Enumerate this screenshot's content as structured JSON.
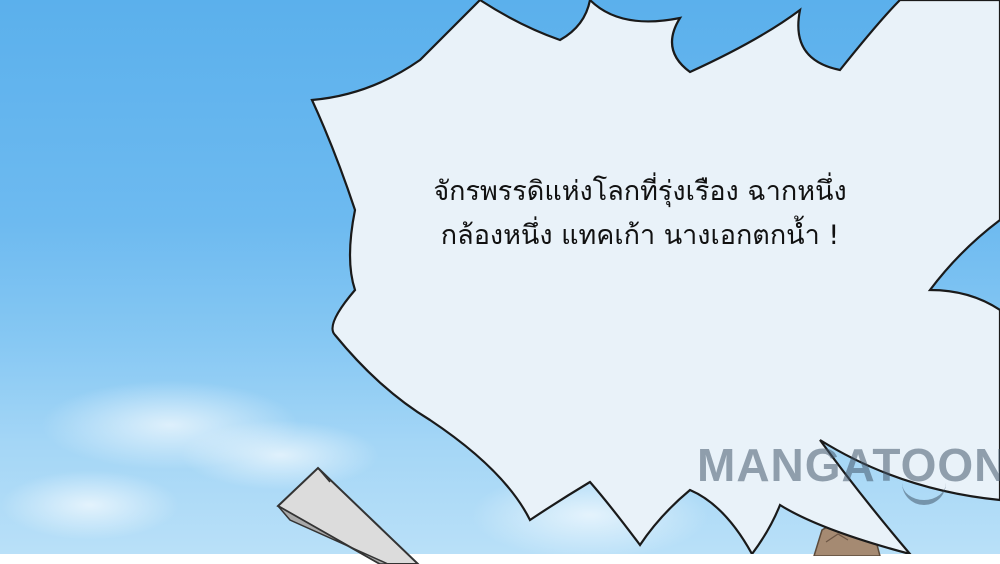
{
  "speech_bubble": {
    "lines": [
      "จักรพรรดิแห่งโลกที่รุ่งเรือง ฉากหนึ่ง",
      "กล้องหนึ่ง แทคเก้า นางเอกตกน้ำ !"
    ]
  },
  "watermark": {
    "text": "MANGATOON"
  },
  "colors": {
    "sky_top": "#5bb0ec",
    "sky_bottom": "#b9e0f8",
    "bubble_fill": "#e9f2f9",
    "bubble_outline": "#1a1a1a",
    "watermark": "#465a6e"
  }
}
